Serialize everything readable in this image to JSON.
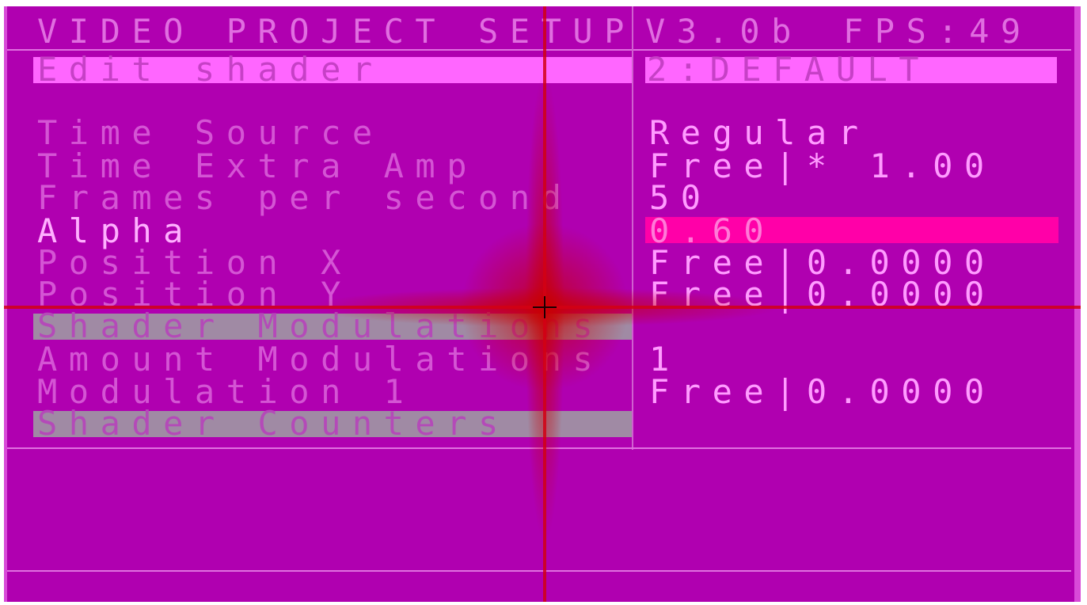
{
  "header": {
    "title": "VIDEO PROJECT SETUP",
    "version": "V3.0b",
    "fps": "FPS:49"
  },
  "edit_row": {
    "label": "Edit shader",
    "value": "2:DEFAULT"
  },
  "params": [
    {
      "label": "Time Source",
      "value": "Regular"
    },
    {
      "label": "Time Extra Amp",
      "value": "Free|* 1.00"
    },
    {
      "label": "Frames per second",
      "value": "50"
    },
    {
      "label": "Alpha",
      "value": "0.60",
      "selected": true
    },
    {
      "label": "Position X",
      "value": "Free|0.0000"
    },
    {
      "label": "Position Y",
      "value": "Free|0.0000"
    },
    {
      "label": "Shader Modulations",
      "value": "",
      "section": true
    },
    {
      "label": "Amount Modulations",
      "value": "1"
    },
    {
      "label": "Modulation 1",
      "value": "Free|0.0000"
    },
    {
      "label": "Shader Counters",
      "value": "",
      "section": true
    }
  ],
  "colors": {
    "background": "#b000b0",
    "dim_text": "#d455d4",
    "highlight_text": "#ffb0ff",
    "edit_bar": "#ff66ff",
    "selected_bar": "#ff00a8",
    "section_bar": "#a08aa4",
    "crosshair": "#d20014"
  }
}
